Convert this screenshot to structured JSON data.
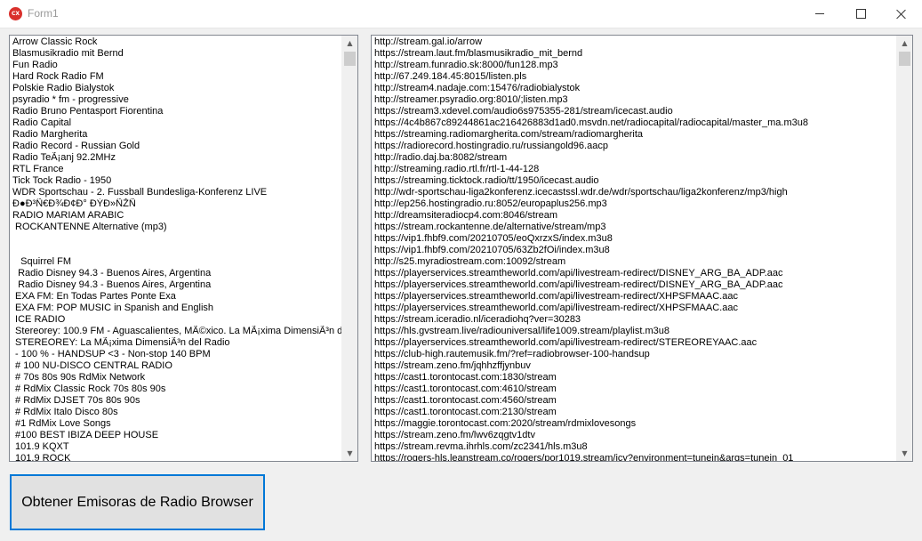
{
  "window": {
    "title": "Form1",
    "app_icon_text": "CX"
  },
  "stations": [
    "Arrow Classic Rock",
    "Blasmusikradio mit Bernd",
    "Fun Radio",
    "Hard Rock Radio FM",
    "Polskie Radio Bialystok",
    "psyradio * fm - progressive",
    "Radio Bruno Pentasport Fiorentina",
    "Radio Capital",
    "Radio Margherita",
    "Radio Record - Russian Gold",
    "Radio TeÃ¡anj 92.2MHz",
    "RTL France",
    "Tick Tock Radio - 1950",
    "WDR Sportschau - 2. Fussball Bundesliga-Konferenz LIVE",
    "Ð●Ð³Ñ€Ð¾Ð¢Ð° ÐÝÐ»ÑŽÑ",
    "RADIO MARIAM ARABIC",
    " ROCKANTENNE Alternative (mp3)",
    "",
    "",
    "   Squirrel FM",
    "  Radio Disney 94.3 - Buenos Aires, Argentina",
    "  Radio Disney 94.3 - Buenos Aires, Argentina",
    " EXA FM: En Todas Partes Ponte Exa",
    " EXA FM: POP MUSIC in Spanish and English",
    " ICE RADIO",
    " Stereorey: 100.9 FM - Aguascalientes, MÃ©xico. La MÃ¡xima DimensiÃ³n de",
    " STEREOREY: La MÃ¡xima DimensiÃ³n del Radio",
    " - 100 % - HANDSUP <3 - Non-stop 140 BPM",
    " # 100 NU-DISCO CENTRAL RADIO",
    " # 70s 80s 90s RdMix Network",
    " # RdMix Classic Rock 70s 80s 90s",
    " # RdMix DJSET 70s 80s 90s",
    " # RdMix Italo Disco 80s",
    " #1 RdMix Love Songs",
    " #100 BEST IBIZA DEEP HOUSE",
    " 101.9 KQXT",
    " 101.9 ROCK"
  ],
  "urls": [
    "http://stream.gal.io/arrow",
    "https://stream.laut.fm/blasmusikradio_mit_bernd",
    "http://stream.funradio.sk:8000/fun128.mp3",
    "http://67.249.184.45:8015/listen.pls",
    "http://stream4.nadaje.com:15476/radiobialystok",
    "http://streamer.psyradio.org:8010/;listen.mp3",
    "https://stream3.xdevel.com/audio6s975355-281/stream/icecast.audio",
    "https://4c4b867c89244861ac216426883d1ad0.msvdn.net/radiocapital/radiocapital/master_ma.m3u8",
    "https://streaming.radiomargherita.com/stream/radiomargherita",
    "https://radiorecord.hostingradio.ru/russiangold96.aacp",
    "http://radio.daj.ba:8082/stream",
    "http://streaming.radio.rtl.fr/rtl-1-44-128",
    "https://streaming.ticktock.radio/tt/1950/icecast.audio",
    "http://wdr-sportschau-liga2konferenz.icecastssl.wdr.de/wdr/sportschau/liga2konferenz/mp3/high",
    "http://ep256.hostingradio.ru:8052/europaplus256.mp3",
    "http://dreamsiteradiocp4.com:8046/stream",
    "https://stream.rockantenne.de/alternative/stream/mp3",
    "https://vip1.fhbf9.com/20210705/eoQxrzxS/index.m3u8",
    "https://vip1.fhbf9.com/20210705/63Zb2fOi/index.m3u8",
    "http://s25.myradiostream.com:10092/stream",
    "https://playerservices.streamtheworld.com/api/livestream-redirect/DISNEY_ARG_BA_ADP.aac",
    "https://playerservices.streamtheworld.com/api/livestream-redirect/DISNEY_ARG_BA_ADP.aac",
    "https://playerservices.streamtheworld.com/api/livestream-redirect/XHPSFMAAC.aac",
    "https://playerservices.streamtheworld.com/api/livestream-redirect/XHPSFMAAC.aac",
    "https://stream.iceradio.nl/iceradiohq?ver=30283",
    "https://hls.gvstream.live/radiouniversal/life1009.stream/playlist.m3u8",
    "https://playerservices.streamtheworld.com/api/livestream-redirect/STEREOREYAAC.aac",
    "https://club-high.rautemusik.fm/?ref=radiobrowser-100-handsup",
    "https://stream.zeno.fm/jqhhzffjynbuv",
    "https://cast1.torontocast.com:1830/stream",
    "https://cast1.torontocast.com:4610/stream",
    "https://cast1.torontocast.com:4560/stream",
    "https://cast1.torontocast.com:2130/stream",
    "https://maggie.torontocast.com:2020/stream/rdmixlovesongs",
    "https://stream.zeno.fm/lwv6zqgtv1dtv",
    "https://stream.revma.ihrhls.com/zc2341/hls.m3u8",
    "https://rogers-hls.leanstream.co/rogers/por1019.stream/icy?environment=tunein&args=tunein_01"
  ],
  "button": {
    "label": "Obtener Emisoras de Radio Browser"
  },
  "scroll_arrows": {
    "up": "▲",
    "down": "▼"
  }
}
